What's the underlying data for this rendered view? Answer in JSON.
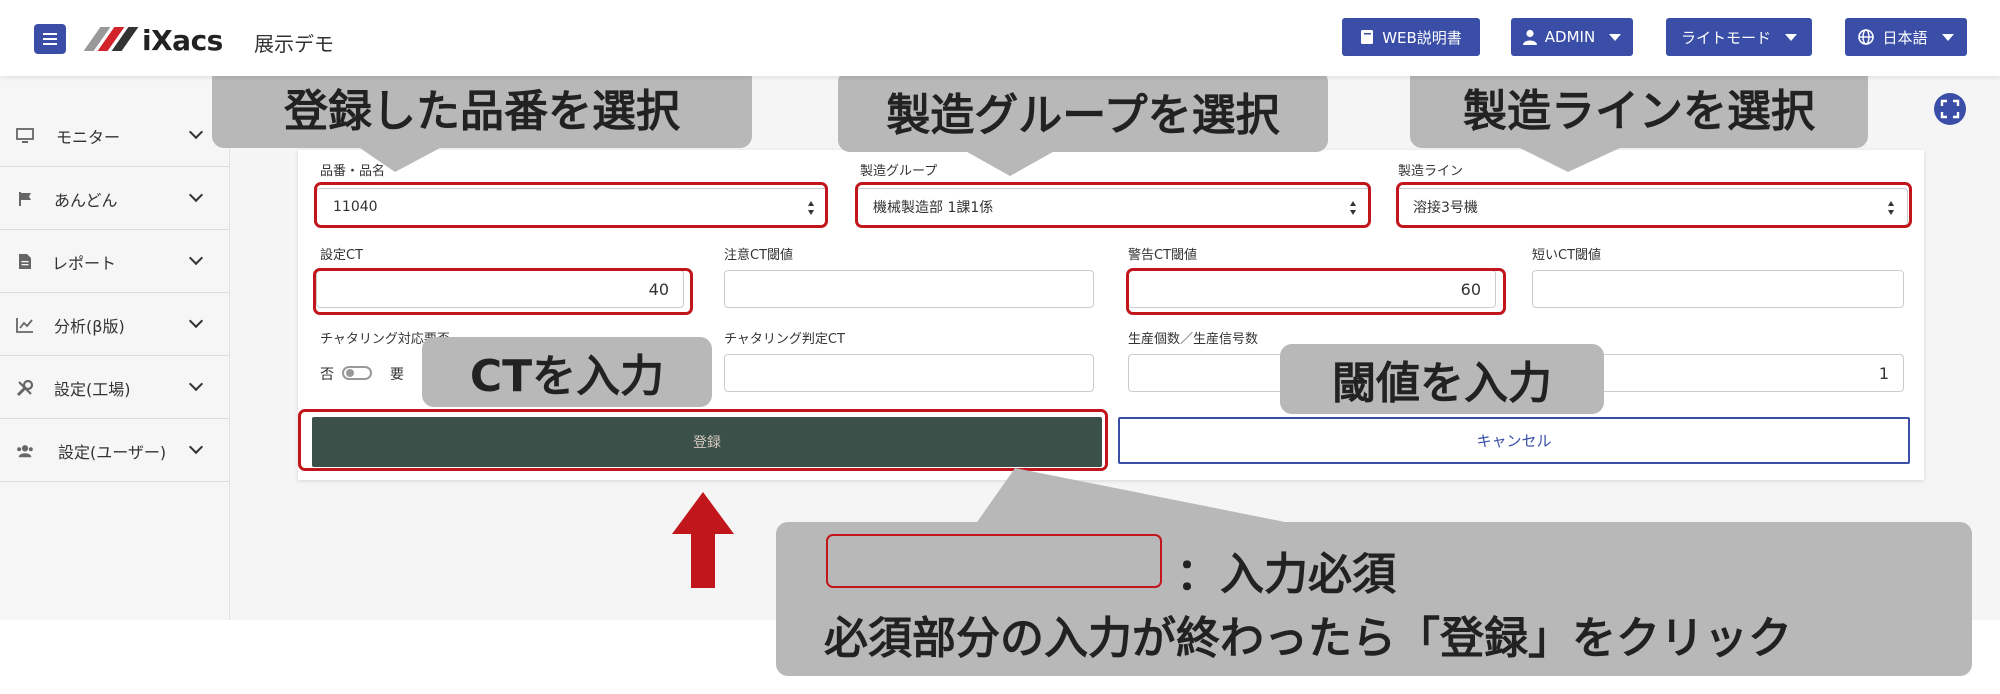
{
  "header": {
    "app_name": "展示デモ",
    "logo_text": "iXacs",
    "buttons": {
      "manual": "WEB説明書",
      "user": "ADMIN",
      "mode": "ライトモード",
      "language": "日本語"
    }
  },
  "sidebar": {
    "items": [
      {
        "label": "モニター",
        "icon": "monitor-icon"
      },
      {
        "label": "あんどん",
        "icon": "flag-icon"
      },
      {
        "label": "レポート",
        "icon": "file-icon"
      },
      {
        "label": "分析(β版)",
        "icon": "chart-icon"
      },
      {
        "label": "設定(工場)",
        "icon": "tools-icon"
      },
      {
        "label": "設定(ユーザー)",
        "icon": "users-icon"
      }
    ]
  },
  "form": {
    "part_label": "品番・品名",
    "part_value": "11040",
    "group_label": "製造グループ",
    "group_value": "機械製造部 1課1係",
    "line_label": "製造ライン",
    "line_value": "溶接3号機",
    "ct_label": "設定CT",
    "ct_value": "40",
    "caution_label": "注意CT閾値",
    "caution_value": "",
    "warning_label": "警告CT閾値",
    "warning_value": "60",
    "short_label": "短いCT閾値",
    "short_value": "",
    "chatter_label": "チャタリング対応要否",
    "chatter_no": "否",
    "chatter_yes": "要",
    "chatter_ct_label": "チャタリング判定CT",
    "chatter_ct_value": "",
    "count_label": "生産個数／生産信号数",
    "count_value": "1",
    "register_button": "登録",
    "cancel_button": "キャンセル"
  },
  "annotations": {
    "select_part": "登録した品番を選択",
    "select_group": "製造グループを選択",
    "select_line": "製造ラインを選択",
    "input_ct": "CTを入力",
    "input_threshold": "閾値を入力",
    "required_legend": "：入力必須",
    "click_register": "必須部分の入力が終わったら「登録」をクリック"
  },
  "colors": {
    "primary": "#3a4ea8",
    "register": "#3b5048",
    "highlight": "#c0161c",
    "callout": "#b8b8b8"
  }
}
